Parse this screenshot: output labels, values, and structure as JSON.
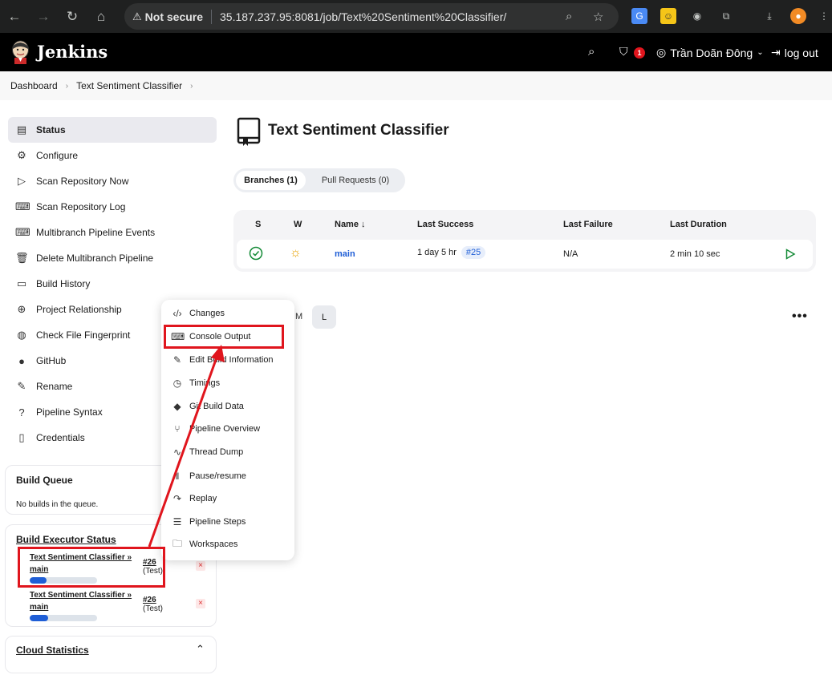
{
  "browser": {
    "security_label": "Not secure",
    "url": "35.187.237.95:8081/job/Text%20Sentiment%20Classifier/"
  },
  "header": {
    "app_name": "Jenkins",
    "security_badge_count": "1",
    "user_name": "Trần Doãn Đông",
    "logout_label": "log out"
  },
  "breadcrumb": {
    "items": [
      "Dashboard",
      "Text Sentiment Classifier"
    ]
  },
  "sidebar": {
    "items": [
      {
        "label": "Status",
        "icon": "document-icon"
      },
      {
        "label": "Configure",
        "icon": "gear-icon"
      },
      {
        "label": "Scan Repository Now",
        "icon": "play-icon"
      },
      {
        "label": "Scan Repository Log",
        "icon": "terminal-icon"
      },
      {
        "label": "Multibranch Pipeline Events",
        "icon": "terminal-icon"
      },
      {
        "label": "Delete Multibranch Pipeline",
        "icon": "trash-icon"
      },
      {
        "label": "Build History",
        "icon": "history-icon"
      },
      {
        "label": "Project Relationship",
        "icon": "relationship-icon"
      },
      {
        "label": "Check File Fingerprint",
        "icon": "fingerprint-icon"
      },
      {
        "label": "GitHub",
        "icon": "github-icon"
      },
      {
        "label": "Rename",
        "icon": "pencil-icon"
      },
      {
        "label": "Pipeline Syntax",
        "icon": "help-icon"
      },
      {
        "label": "Credentials",
        "icon": "credentials-icon"
      }
    ]
  },
  "build_queue": {
    "title": "Build Queue",
    "empty_text": "No builds in the queue."
  },
  "executors": {
    "title": "Build Executor Status",
    "rows": [
      {
        "job": "Text Sentiment Classifier »",
        "branch": "main",
        "build": "#26",
        "stage": "(Test)",
        "progress": 0.25
      },
      {
        "job": "Text Sentiment Classifier »",
        "branch": "main",
        "build": "#26",
        "stage": "(Test)",
        "progress": 0.27
      }
    ]
  },
  "cloud": {
    "title": "Cloud Statistics"
  },
  "main": {
    "title": "Text Sentiment Classifier",
    "tabs": [
      "Branches (1)",
      "Pull Requests (0)"
    ],
    "columns": [
      "S",
      "W",
      "Name ↓",
      "Last Success",
      "Last Failure",
      "Last Duration"
    ],
    "rows": [
      {
        "name": "main",
        "last_success": "1 day 5 hr",
        "last_success_build": "#25",
        "last_failure": "N/A",
        "last_duration": "2 min 10 sec"
      }
    ],
    "size_m": "M",
    "size_l": "L"
  },
  "context_menu": {
    "items": [
      {
        "label": "Changes",
        "icon": "code-icon"
      },
      {
        "label": "Console Output",
        "icon": "terminal-icon"
      },
      {
        "label": "Edit Build Information",
        "icon": "edit-icon"
      },
      {
        "label": "Timings",
        "icon": "clock-icon"
      },
      {
        "label": "Git Build Data",
        "icon": "git-icon"
      },
      {
        "label": "Pipeline Overview",
        "icon": "pipeline-icon"
      },
      {
        "label": "Thread Dump",
        "icon": "pulse-icon"
      },
      {
        "label": "Pause/resume",
        "icon": "pause-icon"
      },
      {
        "label": "Replay",
        "icon": "replay-icon"
      },
      {
        "label": "Pipeline Steps",
        "icon": "list-icon"
      },
      {
        "label": "Workspaces",
        "icon": "folder-icon"
      }
    ]
  },
  "colors": {
    "accent": "#1f5ed6",
    "annotation": "#e0151d",
    "success": "#138a36"
  }
}
